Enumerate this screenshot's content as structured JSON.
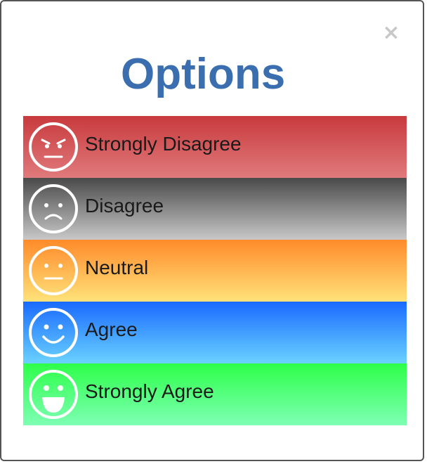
{
  "modal": {
    "title": "Options",
    "close_symbol": "×",
    "close_icon": "close-icon"
  },
  "options": [
    {
      "label": "Strongly Disagree",
      "icon": "angry-face-icon",
      "colors": [
        "#c83a3d",
        "#e07a7c"
      ]
    },
    {
      "label": "Disagree",
      "icon": "sad-face-icon",
      "colors": [
        "#4a4a4a",
        "#c8c8c8"
      ]
    },
    {
      "label": "Neutral",
      "icon": "neutral-face-icon",
      "colors": [
        "#ff8a2a",
        "#ffe27a"
      ]
    },
    {
      "label": "Agree",
      "icon": "smiley-face-icon",
      "colors": [
        "#1a6aff",
        "#6ad2ff"
      ]
    },
    {
      "label": "Strongly Agree",
      "icon": "laughing-face-icon",
      "colors": [
        "#2eff4a",
        "#7effb4"
      ]
    }
  ],
  "colors": {
    "title": "#3a6eaf",
    "close": "#c8c8c8",
    "face_stroke": "#ffffff"
  }
}
